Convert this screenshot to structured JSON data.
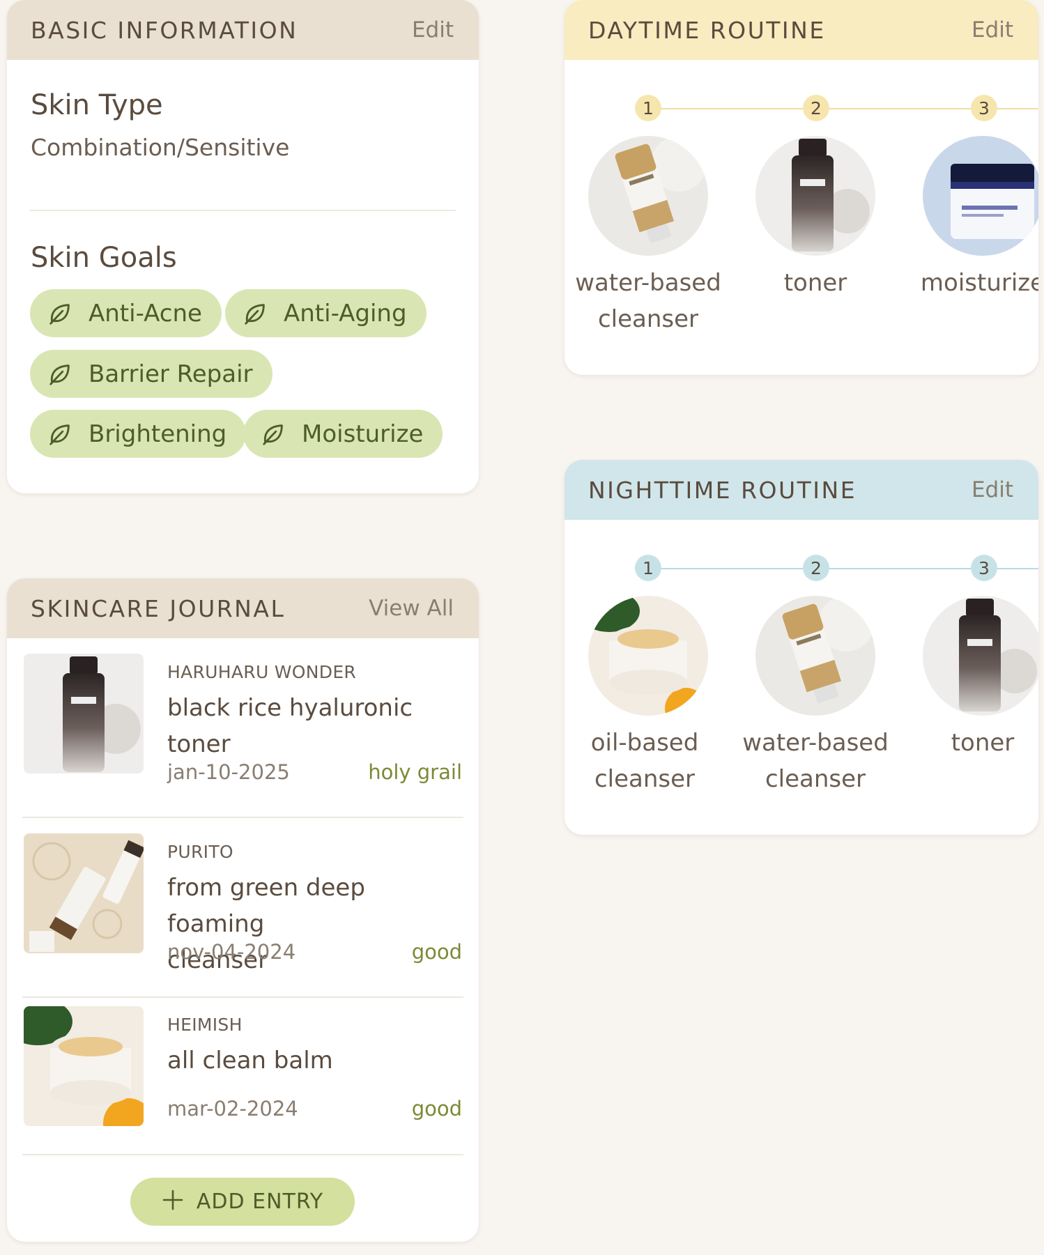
{
  "basic": {
    "title": "BASIC INFORMATION",
    "edit_label": "Edit",
    "skin_type_title": "Skin Type",
    "skin_type_value": "Combination/Sensitive",
    "skin_goals_title": "Skin Goals",
    "goals": [
      "Anti-Acne",
      "Anti-Aging",
      "Barrier Repair",
      "Brightening",
      "Moisturize"
    ],
    "goal_icon": "leaf-icon"
  },
  "daytime": {
    "title": "DAYTIME ROUTINE",
    "edit_label": "Edit",
    "accent": "#f1dea0",
    "steps": [
      {
        "num": "1",
        "label_line1": "water-based",
        "label_line2": "cleanser",
        "image": "centella-cleanser-tube"
      },
      {
        "num": "2",
        "label_line1": "toner",
        "label_line2": "",
        "image": "black-rice-toner-bottle"
      },
      {
        "num": "3",
        "label_line1": "moisturize",
        "label_line2": "",
        "image": "moisturizer-jar"
      }
    ]
  },
  "nighttime": {
    "title": "NIGHTTIME ROUTINE",
    "edit_label": "Edit",
    "accent": "#b9dbe1",
    "steps": [
      {
        "num": "1",
        "label_line1": "oil-based",
        "label_line2": "cleanser",
        "image": "cleansing-balm-jar"
      },
      {
        "num": "2",
        "label_line1": "water-based",
        "label_line2": "cleanser",
        "image": "centella-cleanser-tube"
      },
      {
        "num": "3",
        "label_line1": "toner",
        "label_line2": "",
        "image": "black-rice-toner-bottle"
      }
    ]
  },
  "journal": {
    "title": "SKINCARE JOURNAL",
    "view_all_label": "View All",
    "entries": [
      {
        "brand": "HARUHARU WONDER",
        "name_line1": "black rice hyaluronic",
        "name_line2": "toner",
        "date": "jan-10-2025",
        "rating": "holy grail",
        "image": "black-rice-toner-bottle"
      },
      {
        "brand": "PURITO",
        "name_line1": "from green deep foaming",
        "name_line2": "cleanser",
        "date": "nov-04-2024",
        "rating": "good",
        "image": "foaming-cleanser-tubes"
      },
      {
        "brand": "HEIMISH",
        "name_line1": "all clean balm",
        "name_line2": "",
        "date": "mar-02-2024",
        "rating": "good",
        "image": "cleansing-balm-jar"
      }
    ],
    "add_label": "ADD ENTRY",
    "add_icon": "plus-icon"
  },
  "colors": {
    "background": "#f8f4f0",
    "chip": "#d9e6b3",
    "rating": "#7a8a35"
  }
}
